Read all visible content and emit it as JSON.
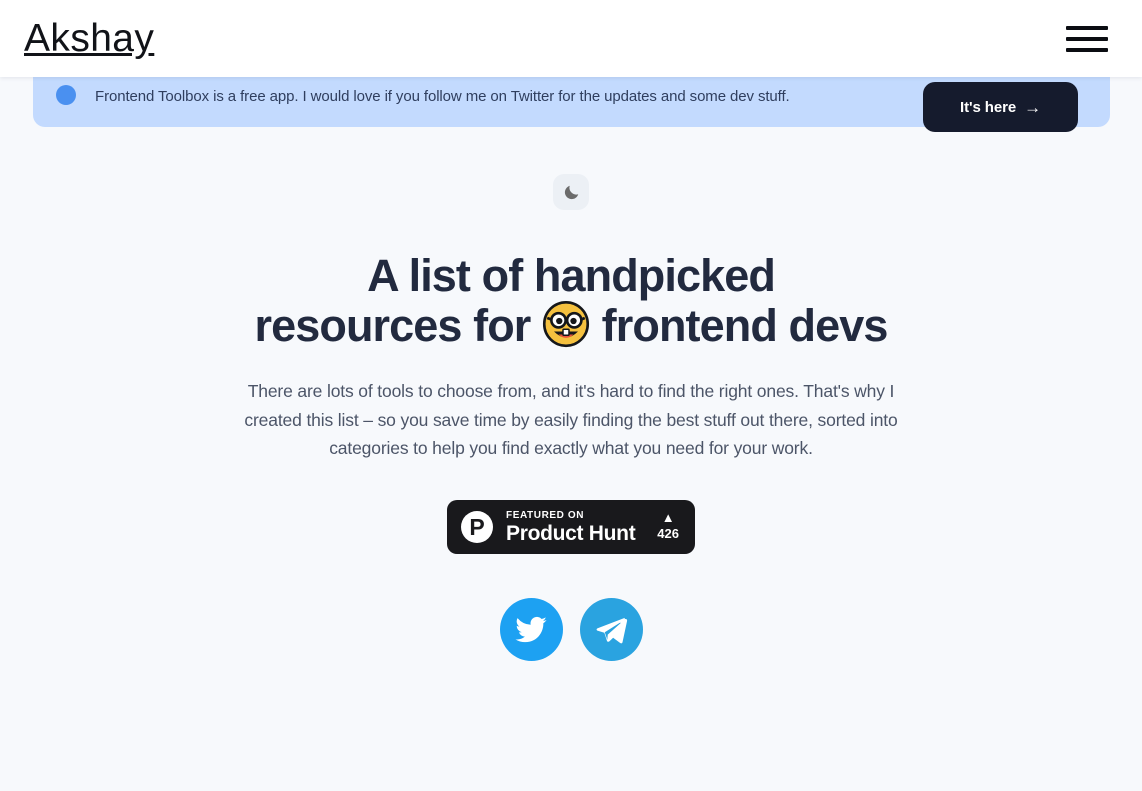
{
  "header": {
    "brand": "Akshay",
    "menu_icon": "hamburger-menu-icon"
  },
  "banner": {
    "icon": "blue-dot-icon",
    "message": "Frontend Toolbox is a free app. I would love if you follow me on Twitter for the updates and some dev stuff.",
    "cta_label": "It's here",
    "cta_arrow": "→",
    "background_color": "#c3dafe",
    "cta_color": "#151b2d"
  },
  "hero": {
    "theme_toggle_icon": "moon-icon",
    "title_line1": "A list of handpicked",
    "title_line2_before": "resources for",
    "title_emoji": "nerd-face-emoji",
    "title_line2_after": "frontend devs",
    "subtitle": "There are lots of tools to choose from, and it's hard to find the right ones. That's why I created this list – so you save time by easily finding the best stuff out there, sorted into categories to help you find exactly what you need for your work."
  },
  "product_hunt": {
    "logo_letter": "P",
    "featured_label": "FEATURED ON",
    "name": "Product Hunt",
    "caret": "▲",
    "votes": "426",
    "background_color": "#19191c"
  },
  "social": [
    {
      "name": "twitter",
      "icon": "twitter-icon",
      "color": "#1da1f2"
    },
    {
      "name": "telegram",
      "icon": "telegram-icon",
      "color": "#2aa3e0"
    }
  ],
  "page": {
    "background_color": "#f7f9fc"
  }
}
